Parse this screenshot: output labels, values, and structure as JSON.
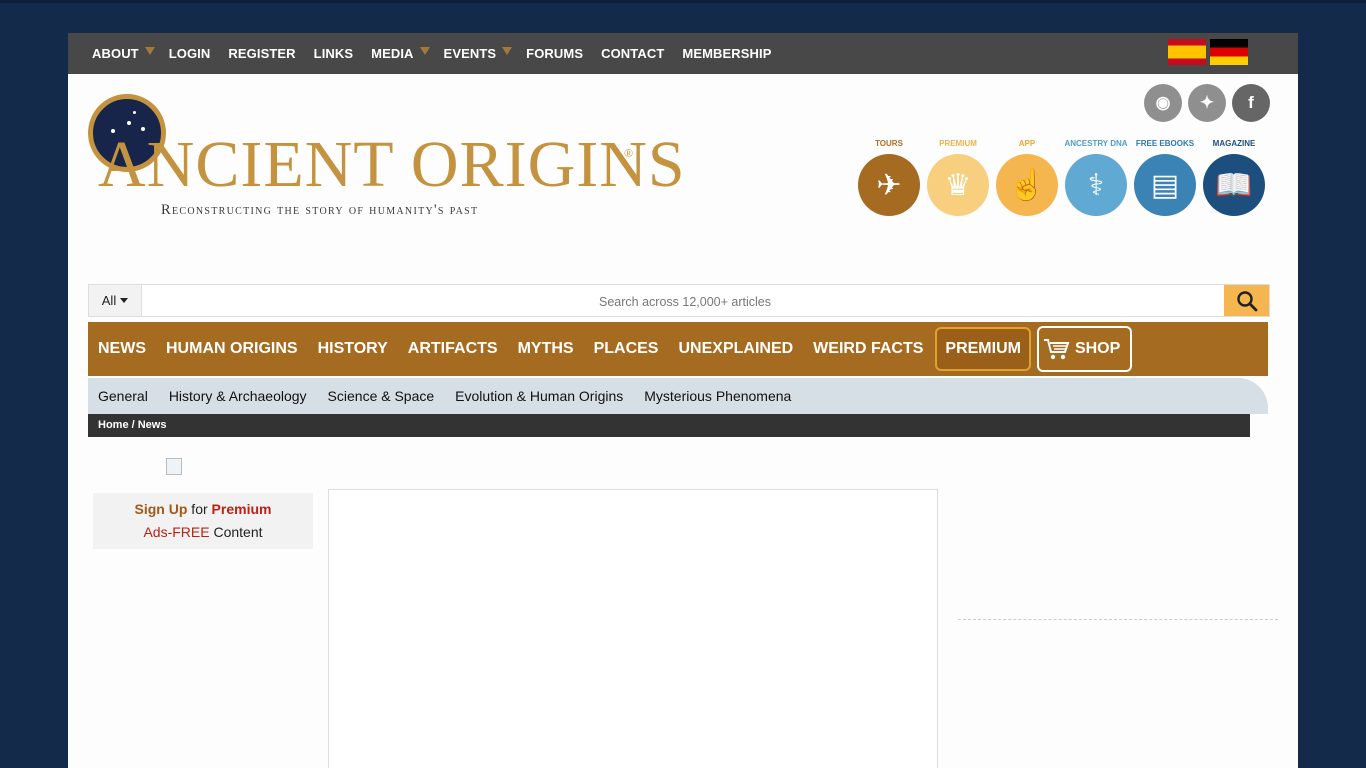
{
  "topnav": {
    "items": [
      {
        "label": "ABOUT",
        "dropdown": true
      },
      {
        "label": "LOGIN",
        "dropdown": false
      },
      {
        "label": "REGISTER",
        "dropdown": false
      },
      {
        "label": "LINKS",
        "dropdown": false
      },
      {
        "label": "MEDIA",
        "dropdown": true
      },
      {
        "label": "EVENTS",
        "dropdown": true
      },
      {
        "label": "FORUMS",
        "dropdown": false
      },
      {
        "label": "CONTACT",
        "dropdown": false
      },
      {
        "label": "MEMBERSHIP",
        "dropdown": false
      }
    ],
    "flags": [
      "spain-flag",
      "germany-flag"
    ]
  },
  "logo": {
    "name": "ANCIENT ORIGINS",
    "tagline": "Reconstructing the story of humanity's past",
    "reg": "®"
  },
  "social": [
    "rss-icon",
    "twitter-icon",
    "facebook-icon"
  ],
  "social_glyphs": {
    "rss": "◉",
    "twitter": "✦",
    "facebook": "f"
  },
  "circle_buttons": [
    {
      "label": "TOURS",
      "color": "#a56b21",
      "label_color": "#b07022",
      "icon": "globe-plane-icon",
      "glyph": "✈"
    },
    {
      "label": "PREMIUM",
      "color": "#f8cf7e",
      "label_color": "#f0b24d",
      "icon": "crown-icon",
      "glyph": "♛"
    },
    {
      "label": "APP",
      "color": "#f5b650",
      "label_color": "#f0a830",
      "icon": "phone-icon",
      "glyph": "☝"
    },
    {
      "label": "ANCESTRY DNA",
      "color": "#5fa9d3",
      "label_color": "#4f9cc8",
      "icon": "dna-icon",
      "glyph": "⚕"
    },
    {
      "label": "FREE EBOOKS",
      "color": "#3b82b5",
      "label_color": "#2f78ae",
      "icon": "ebook-icon",
      "glyph": "▤"
    },
    {
      "label": "MAGAZINE",
      "color": "#1d4f7e",
      "label_color": "#1d4f7e",
      "icon": "book-icon",
      "glyph": "📖"
    }
  ],
  "search": {
    "category": "All",
    "placeholder": "Search across 12,000+ articles"
  },
  "mainnav": {
    "items": [
      "NEWS",
      "HUMAN ORIGINS",
      "HISTORY",
      "ARTIFACTS",
      "MYTHS",
      "PLACES",
      "UNEXPLAINED",
      "WEIRD FACTS"
    ],
    "premium": "PREMIUM",
    "shop": "SHOP"
  },
  "subnav": {
    "items": [
      "General",
      "History & Archaeology",
      "Science & Space",
      "Evolution & Human Origins",
      "Mysterious Phenomena"
    ]
  },
  "breadcrumb": {
    "home": "Home",
    "sep": " / ",
    "current": "News"
  },
  "promo": {
    "signup": "Sign Up",
    "for": " for ",
    "premium": "Premium",
    "adsfree": "Ads-FREE",
    "content": " Content"
  }
}
